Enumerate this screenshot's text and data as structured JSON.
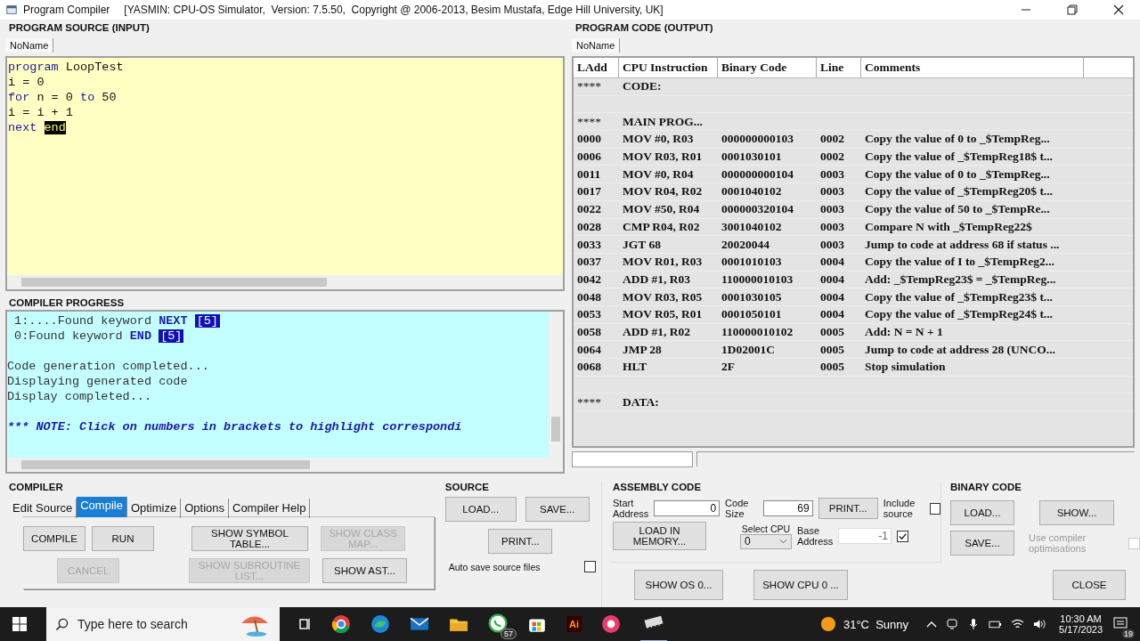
{
  "window": {
    "title": "Program Compiler",
    "subtitle": "[YASMIN: CPU-OS Simulator,  Version: 7.5.50,  Copyright @ 2006-2013, Besim Mustafa, Edge Hill University, UK]"
  },
  "source": {
    "heading": "PROGRAM SOURCE (INPUT)",
    "tabs": [
      {
        "label": "NoName",
        "selected": true
      }
    ],
    "lines": [
      [
        {
          "text": "program",
          "kind": "keyword"
        },
        {
          "text": " LoopTest",
          "kind": "plain"
        }
      ],
      [
        {
          "text": "i = 0",
          "kind": "plain"
        }
      ],
      [
        {
          "text": "for",
          "kind": "keyword"
        },
        {
          "text": " n = 0 ",
          "kind": "plain"
        },
        {
          "text": "to",
          "kind": "keyword"
        },
        {
          "text": " 50",
          "kind": "plain"
        }
      ],
      [
        {
          "text": "i = i + 1",
          "kind": "plain"
        }
      ],
      [
        {
          "text": "next ",
          "kind": "keyword"
        },
        {
          "text": "end",
          "kind": "selected"
        }
      ]
    ]
  },
  "progress": {
    "heading": "COMPILER PROGRESS",
    "lines": [
      {
        "kind": "text",
        "segments": [
          {
            "text": " 1:....Found keyword ",
            "kind": "plain"
          },
          {
            "text": "NEXT ",
            "kind": "keyword"
          },
          {
            "text": "[5]",
            "kind": "ref"
          }
        ]
      },
      {
        "kind": "text",
        "segments": [
          {
            "text": " 0:Found keyword ",
            "kind": "plain"
          },
          {
            "text": "END ",
            "kind": "keyword"
          },
          {
            "text": "[5]",
            "kind": "ref"
          }
        ]
      },
      {
        "kind": "blank"
      },
      {
        "kind": "text",
        "segments": [
          {
            "text": "Code generation completed...",
            "kind": "plain"
          }
        ]
      },
      {
        "kind": "text",
        "segments": [
          {
            "text": "Displaying generated code",
            "kind": "plain"
          }
        ]
      },
      {
        "kind": "text",
        "segments": [
          {
            "text": "Display completed...",
            "kind": "plain"
          }
        ]
      },
      {
        "kind": "blank"
      },
      {
        "kind": "text",
        "segments": [
          {
            "text": "*** NOTE: Click on numbers in brackets to highlight correspondi",
            "kind": "note"
          }
        ]
      }
    ]
  },
  "output": {
    "heading": "PROGRAM CODE (OUTPUT)",
    "tabs": [
      {
        "label": "NoName",
        "selected": true
      }
    ],
    "columns": [
      "LAdd",
      "CPU Instruction",
      "Binary Code",
      "Line",
      "Comments"
    ],
    "rows": [
      {
        "kind": "section",
        "cells": [
          "****",
          "CODE:"
        ]
      },
      {
        "kind": "blank"
      },
      {
        "kind": "section",
        "cells": [
          "****",
          "MAIN PROG..."
        ]
      },
      {
        "kind": "code",
        "cells": [
          "0000",
          "MOV #0, R03",
          "000000000103",
          "0002",
          "Copy the value of  0 to _$TempReg..."
        ]
      },
      {
        "kind": "code",
        "cells": [
          "0006",
          "MOV R03, R01",
          "0001030101",
          "0002",
          "Copy the value of _$TempReg18$ t..."
        ]
      },
      {
        "kind": "code",
        "cells": [
          "0011",
          "MOV #0, R04",
          "000000000104",
          "0003",
          "Copy the value of  0 to _$TempReg..."
        ]
      },
      {
        "kind": "code",
        "cells": [
          "0017",
          "MOV R04, R02",
          "0001040102",
          "0003",
          "Copy the value of _$TempReg20$ t..."
        ]
      },
      {
        "kind": "code",
        "cells": [
          "0022",
          "MOV #50, R04",
          "000000320104",
          "0003",
          "Copy the value of  50 to _$TempRe..."
        ]
      },
      {
        "kind": "code",
        "cells": [
          "0028",
          "CMP R04, R02",
          "3001040102",
          "0003",
          "Compare N with _$TempReg22$"
        ]
      },
      {
        "kind": "code",
        "cells": [
          "0033",
          "JGT 68",
          "20020044",
          "0003",
          "Jump to code at address 68 if status ..."
        ]
      },
      {
        "kind": "code",
        "cells": [
          "0037",
          "MOV R01, R03",
          "0001010103",
          "0004",
          "Copy the value of I to _$TempReg2..."
        ]
      },
      {
        "kind": "code",
        "cells": [
          "0042",
          "ADD #1, R03",
          "110000010103",
          "0004",
          "Add: _$TempReg23$ = _$TempReg..."
        ]
      },
      {
        "kind": "code",
        "cells": [
          "0048",
          "MOV R03, R05",
          "0001030105",
          "0004",
          "Copy the value of _$TempReg23$ t..."
        ]
      },
      {
        "kind": "code",
        "cells": [
          "0053",
          "MOV R05, R01",
          "0001050101",
          "0004",
          "Copy the value of _$TempReg24$ t..."
        ]
      },
      {
        "kind": "code",
        "cells": [
          "0058",
          "ADD #1, R02",
          "110000010102",
          "0005",
          "Add: N = N + 1"
        ]
      },
      {
        "kind": "code",
        "cells": [
          "0064",
          "JMP 28",
          "1D02001C",
          "0005",
          "Jump to code at address  28 (UNCO..."
        ]
      },
      {
        "kind": "code",
        "cells": [
          "0068",
          "HLT",
          "2F",
          "0005",
          "Stop simulation"
        ]
      },
      {
        "kind": "blank"
      },
      {
        "kind": "section",
        "cells": [
          "****",
          "DATA:"
        ]
      }
    ]
  },
  "compiler": {
    "heading": "COMPILER",
    "tabs": [
      {
        "label": "Edit Source",
        "selected": false
      },
      {
        "label": "Compile",
        "selected": true
      },
      {
        "label": "Optimize",
        "selected": false
      },
      {
        "label": "Options",
        "selected": false
      },
      {
        "label": "Compiler Help",
        "selected": false
      }
    ],
    "button_rows": [
      [
        {
          "label": "COMPILE",
          "disabled": false
        },
        {
          "label": "RUN",
          "disabled": false
        },
        {
          "label": "SHOW SYMBOL TABLE...",
          "disabled": false
        },
        {
          "label": "SHOW CLASS MAP...",
          "disabled": true
        }
      ],
      [
        {
          "label": "CANCEL",
          "disabled": true
        },
        {
          "label": "SHOW SUBROUTINE LIST...",
          "disabled": true
        },
        {
          "label": "SHOW AST...",
          "disabled": false
        }
      ]
    ]
  },
  "source_panel": {
    "heading": "SOURCE",
    "load": "LOAD...",
    "save": "SAVE...",
    "print": "PRINT...",
    "auto_save": {
      "label": "Auto save source files",
      "checked": false
    }
  },
  "assembly": {
    "heading": "ASSEMBLY CODE",
    "start_address": {
      "label": "Start Address",
      "value": "0"
    },
    "code_size": {
      "label": "Code Size",
      "value": "69"
    },
    "print": "PRINT...",
    "include_source": {
      "label": "Include source",
      "checked": false
    },
    "load_in_memory": "LOAD IN MEMORY...",
    "select_cpu": {
      "label": "Select CPU",
      "value": "0"
    },
    "base_address": {
      "label": "Base Address",
      "value": "-1",
      "checked": true
    }
  },
  "binary": {
    "heading": "BINARY CODE",
    "load": "LOAD...",
    "show": "SHOW...",
    "save": "SAVE...",
    "use_optimisations": {
      "label": "Use compiler optimisations",
      "checked": false,
      "disabled": true
    }
  },
  "footer_buttons": [
    "SHOW OS 0...",
    "SHOW CPU 0 ...",
    "CLOSE"
  ],
  "taskbar": {
    "search_placeholder": "Type here to search",
    "app_badge": "57",
    "ai_label": "Ai",
    "weather": "31°C  Sunny",
    "time": "10:30 AM",
    "date": "5/17/2023",
    "notifications": "19"
  }
}
